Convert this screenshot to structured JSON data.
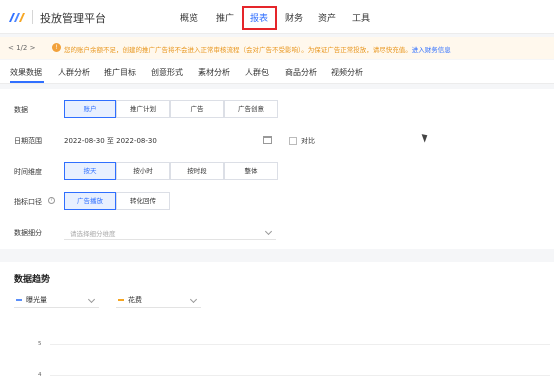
{
  "app": {
    "title": "投放管理平台"
  },
  "nav": [
    {
      "label": "概览",
      "active": false
    },
    {
      "label": "推广",
      "active": false
    },
    {
      "label": "报表",
      "active": true
    },
    {
      "label": "财务",
      "active": false
    },
    {
      "label": "资产",
      "active": false
    },
    {
      "label": "工具",
      "active": false
    }
  ],
  "notice": {
    "pager": "< 1/2 >",
    "message": "您的账户余额不足，创建的推广广告将不会进入正常审核流程（会对广告不受影响）。为保证广告正常投放，请尽快充值。",
    "link": "进入财务信息"
  },
  "subtabs": [
    "效果数据",
    "人群分析",
    "推广目标",
    "创意形式",
    "素材分析",
    "人群包",
    "商品分析",
    "视频分析"
  ],
  "filters": {
    "data": {
      "label": "数据",
      "options": [
        "账户",
        "推广计划",
        "广告",
        "广告创意"
      ],
      "selected": 0
    },
    "date": {
      "label": "日期范围",
      "value": "2022-08-30 至 2022-08-30",
      "compare_label": "对比"
    },
    "time": {
      "label": "时间维度",
      "options": [
        "按天",
        "按小时",
        "按时段",
        "整体"
      ],
      "selected": 0
    },
    "metric": {
      "label": "指标口径",
      "options": [
        "广告播放",
        "转化回传"
      ],
      "selected": 0
    },
    "breakdown": {
      "label": "数据细分",
      "placeholder": "请选择细分维度"
    }
  },
  "trend": {
    "title": "数据趋势",
    "metrics": [
      {
        "label": "曝光量",
        "color": "#5b8ff9"
      },
      {
        "label": "花费",
        "color": "#f6a623"
      }
    ],
    "y_ticks": [
      "5",
      "4"
    ]
  },
  "colors": {
    "accent": "#2f6fff",
    "highlight_box": "#e5252a",
    "warning": "#e8961e"
  }
}
